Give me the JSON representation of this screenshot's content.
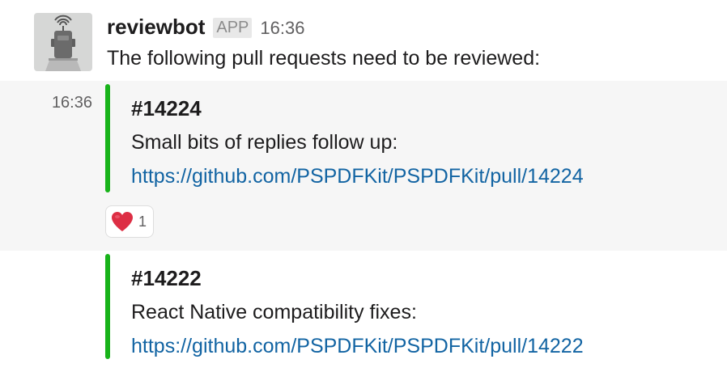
{
  "message": {
    "bot_name": "reviewbot",
    "badge": "APP",
    "time": "16:36",
    "intro": "The following pull requests need to be reviewed:"
  },
  "hover_time": "16:36",
  "attachments": [
    {
      "title": "#14224",
      "description": "Small bits of replies follow up:",
      "link": "https://github.com/PSPDFKit/PSPDFKit/pull/14224"
    },
    {
      "title": "#14222",
      "description": "React Native compatibility fixes:",
      "link": "https://github.com/PSPDFKit/PSPDFKit/pull/14222"
    }
  ],
  "reaction": {
    "emoji": "heart-icon",
    "count": "1"
  },
  "colors": {
    "attachment_bar": "#18b31a",
    "link": "#1264a3",
    "hover_background": "#f6f6f6"
  }
}
